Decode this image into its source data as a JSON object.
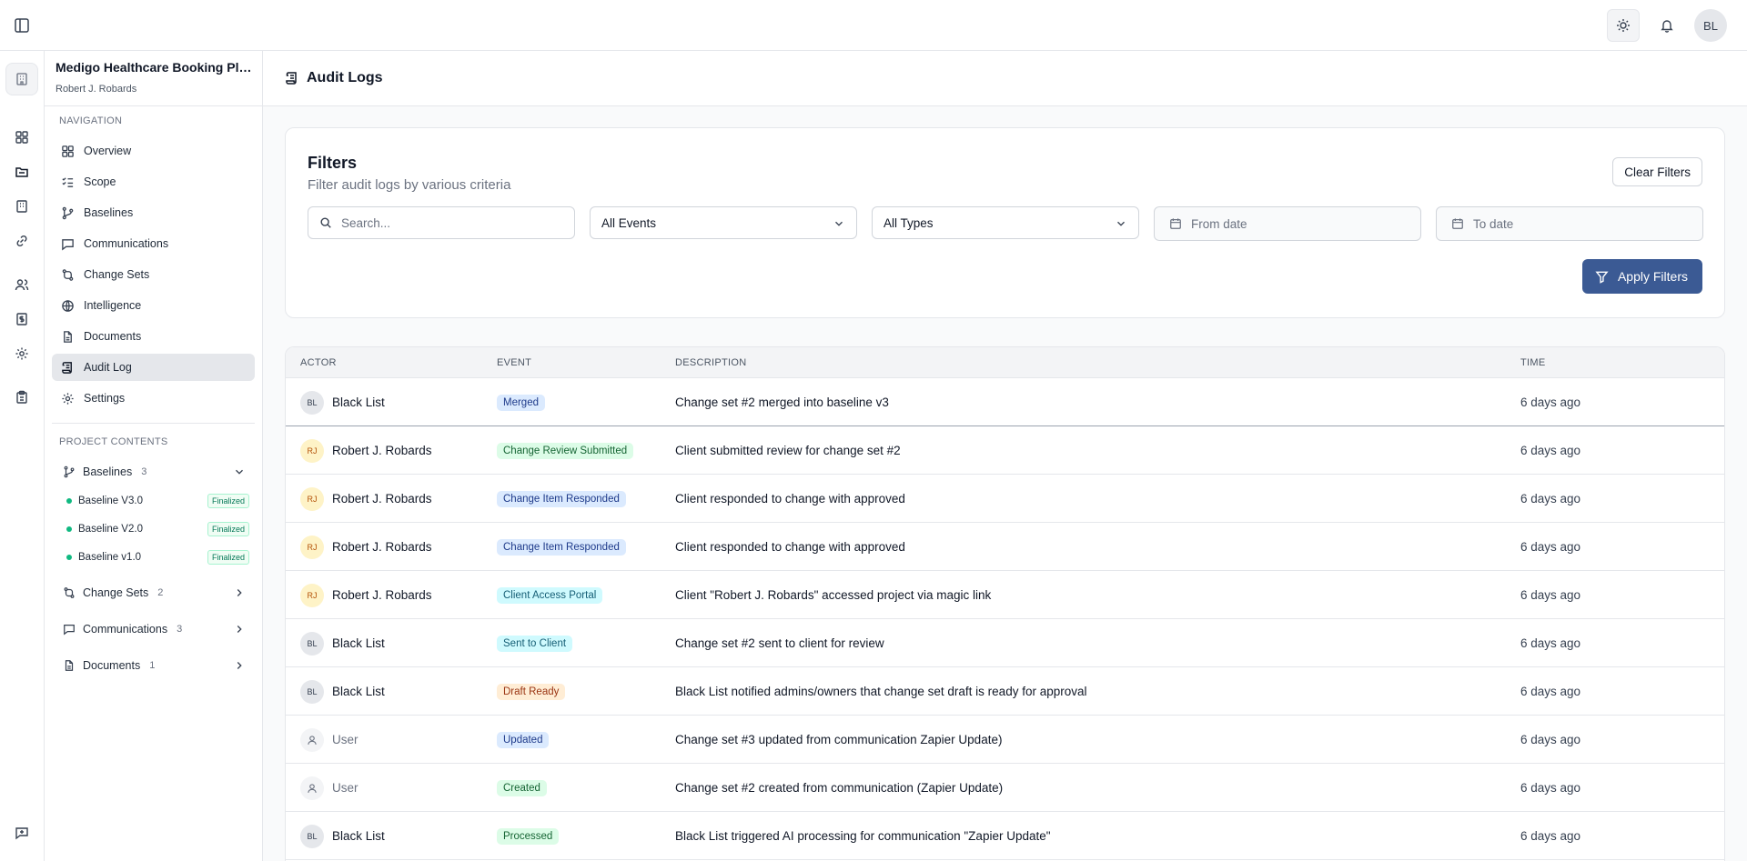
{
  "header": {
    "avatar_initials": "BL"
  },
  "sidebar": {
    "project_name": "Medigo Healthcare Booking Platform",
    "client_name": "Robert J. Robards",
    "nav_label": "NAVIGATION",
    "nav_items": [
      {
        "label": "Overview",
        "icon": "grid-icon"
      },
      {
        "label": "Scope",
        "icon": "checklist-icon"
      },
      {
        "label": "Baselines",
        "icon": "branch-icon"
      },
      {
        "label": "Communications",
        "icon": "message-icon"
      },
      {
        "label": "Change Sets",
        "icon": "git-compare-icon"
      },
      {
        "label": "Intelligence",
        "icon": "globe-icon"
      },
      {
        "label": "Documents",
        "icon": "file-icon"
      },
      {
        "label": "Audit Log",
        "icon": "scroll-icon",
        "active": true
      },
      {
        "label": "Settings",
        "icon": "gear-icon"
      }
    ],
    "contents_label": "PROJECT CONTENTS",
    "contents": {
      "baselines": {
        "label": "Baselines",
        "count": "3"
      },
      "baseline_items": [
        {
          "label": "Baseline V3.0",
          "badge": "Finalized"
        },
        {
          "label": "Baseline V2.0",
          "badge": "Finalized"
        },
        {
          "label": "Baseline v1.0",
          "badge": "Finalized"
        }
      ],
      "change_sets": {
        "label": "Change Sets",
        "count": "2"
      },
      "communications": {
        "label": "Communications",
        "count": "3"
      },
      "documents": {
        "label": "Documents",
        "count": "1"
      }
    }
  },
  "page": {
    "title": "Audit Logs"
  },
  "filters": {
    "title": "Filters",
    "subtitle": "Filter audit logs by various criteria",
    "clear_label": "Clear Filters",
    "search_placeholder": "Search...",
    "events_value": "All Events",
    "types_value": "All Types",
    "from_placeholder": "From date",
    "to_placeholder": "To date",
    "apply_label": "Apply Filters"
  },
  "table": {
    "columns": [
      "ACTOR",
      "EVENT",
      "DESCRIPTION",
      "TIME"
    ],
    "rows": [
      {
        "initials": "BL",
        "actor": "Black List",
        "avatar": "bl",
        "event": "Merged",
        "event_color": "blue",
        "description": "Change set #2 merged into baseline v3",
        "time": "6 days ago"
      },
      {
        "initials": "RJ",
        "actor": "Robert J. Robards",
        "avatar": "rj",
        "event": "Change Review Submitted",
        "event_color": "green",
        "description": "Client submitted review for change set #2",
        "time": "6 days ago"
      },
      {
        "initials": "RJ",
        "actor": "Robert J. Robards",
        "avatar": "rj",
        "event": "Change Item Responded",
        "event_color": "blue",
        "description": "Client responded to change with approved",
        "time": "6 days ago"
      },
      {
        "initials": "RJ",
        "actor": "Robert J. Robards",
        "avatar": "rj",
        "event": "Change Item Responded",
        "event_color": "blue",
        "description": "Client responded to change with approved",
        "time": "6 days ago"
      },
      {
        "initials": "RJ",
        "actor": "Robert J. Robards",
        "avatar": "rj",
        "event": "Client Access Portal",
        "event_color": "cyan",
        "description": "Client \"Robert J. Robards\" accessed project via magic link",
        "time": "6 days ago"
      },
      {
        "initials": "BL",
        "actor": "Black List",
        "avatar": "bl",
        "event": "Sent to Client",
        "event_color": "cyan",
        "description": "Change set #2 sent to client for review",
        "time": "6 days ago"
      },
      {
        "initials": "BL",
        "actor": "Black List",
        "avatar": "bl",
        "event": "Draft Ready",
        "event_color": "orange",
        "description": "Black List notified admins/owners that change set draft is ready for approval",
        "time": "6 days ago"
      },
      {
        "initials": "",
        "actor": "User",
        "avatar": "user",
        "event": "Updated",
        "event_color": "blue",
        "description": "Change set #3 updated from communication Zapier Update)",
        "time": "6 days ago"
      },
      {
        "initials": "",
        "actor": "User",
        "avatar": "user",
        "event": "Created",
        "event_color": "green",
        "description": "Change set #2 created from communication (Zapier Update)",
        "time": "6 days ago"
      },
      {
        "initials": "BL",
        "actor": "Black List",
        "avatar": "bl",
        "event": "Processed",
        "event_color": "green",
        "description": "Black List triggered AI processing for communication \"Zapier Update\"",
        "time": "6 days ago"
      }
    ]
  },
  "colors": {
    "primary": "#3b5a94",
    "finalized": "#10b981"
  }
}
